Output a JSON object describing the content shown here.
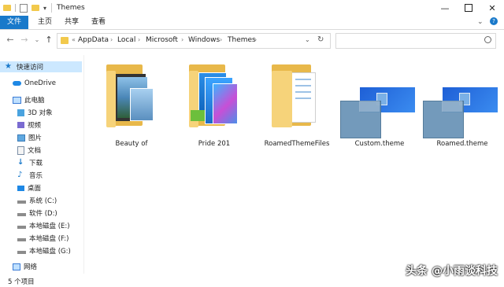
{
  "window": {
    "title": "Themes"
  },
  "ribbon": {
    "tabs": [
      "文件",
      "主页",
      "共享",
      "查看"
    ]
  },
  "address": {
    "prefix": "«",
    "crumbs": [
      "AppData",
      "Local",
      "Microsoft",
      "Windows",
      "Themes"
    ]
  },
  "sidebar": {
    "items": [
      {
        "label": "快速访问",
        "icon": "star-icon"
      },
      {
        "label": "OneDrive",
        "icon": "cloud-icon"
      },
      {
        "label": "此电脑",
        "icon": "computer-icon"
      },
      {
        "label": "3D 对象",
        "icon": "cube-icon"
      },
      {
        "label": "视频",
        "icon": "video-icon"
      },
      {
        "label": "图片",
        "icon": "picture-icon"
      },
      {
        "label": "文档",
        "icon": "document-icon"
      },
      {
        "label": "下载",
        "icon": "download-icon"
      },
      {
        "label": "音乐",
        "icon": "music-icon"
      },
      {
        "label": "桌面",
        "icon": "desktop-icon"
      },
      {
        "label": "系统 (C:)",
        "icon": "drive-icon"
      },
      {
        "label": "软件 (D:)",
        "icon": "drive-icon"
      },
      {
        "label": "本地磁盘 (E:)",
        "icon": "drive-icon"
      },
      {
        "label": "本地磁盘 (F:)",
        "icon": "drive-icon"
      },
      {
        "label": "本地磁盘 (G:)",
        "icon": "drive-icon"
      },
      {
        "label": "网络",
        "icon": "network-icon"
      }
    ]
  },
  "files": [
    {
      "name": "Beauty of",
      "kind": "folder-photos"
    },
    {
      "name": "Pride 201",
      "kind": "folder-pride"
    },
    {
      "name": "RoamedThemeFiles",
      "kind": "folder-docs"
    },
    {
      "name": "Custom.theme",
      "kind": "theme-file"
    },
    {
      "name": "Roamed.theme",
      "kind": "theme-file"
    }
  ],
  "status": {
    "count_text": "5 个项目"
  },
  "watermark": "头条 @小雨谈科技",
  "colors": {
    "accent": "#1979ca",
    "selected": "#cce8ff",
    "folder": "#f6d37a"
  }
}
